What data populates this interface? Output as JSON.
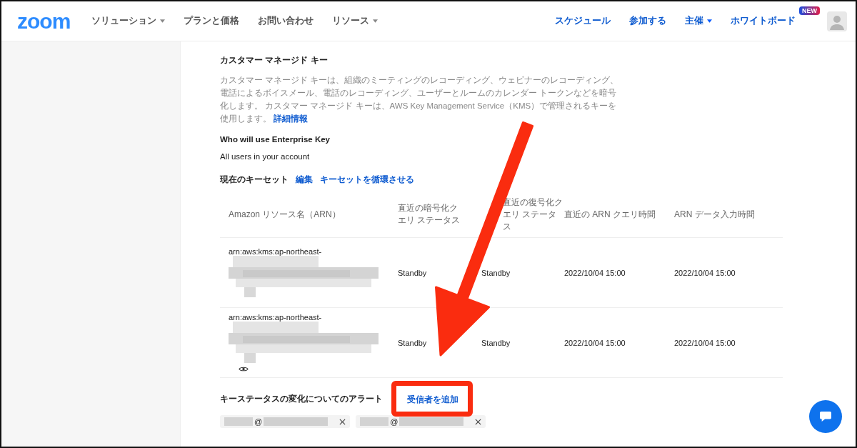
{
  "nav": {
    "logo": "zoom",
    "left_menu": [
      {
        "label": "ソリューション",
        "dropdown": true
      },
      {
        "label": "プランと価格",
        "dropdown": false
      },
      {
        "label": "お問い合わせ",
        "dropdown": false
      },
      {
        "label": "リソース",
        "dropdown": true
      }
    ],
    "right_menu": [
      {
        "label": "スケジュール",
        "dropdown": false
      },
      {
        "label": "参加する",
        "dropdown": false
      },
      {
        "label": "主催",
        "dropdown": true
      },
      {
        "label": "ホワイトボード",
        "dropdown": false,
        "badge": "NEW"
      }
    ]
  },
  "section": {
    "title": "カスタマー マネージド キー",
    "description": "カスタマー マネージド キーは、組織のミーティングのレコーディング、ウェビナーのレコーディング、電話によるボイスメール、電話のレコーディング、ユーザーとルームのカレンダー トークンなどを暗号化します。 カスタマー マネージド キーは、AWS Key Management Service（KMS）で管理されるキーを使用します。",
    "more_link": "詳細情報",
    "who_label": "Who will use Enterprise Key",
    "who_value": "All users in your account"
  },
  "keyset": {
    "title": "現在のキーセット",
    "links": [
      "編集",
      "キーセットを循環させる"
    ],
    "columns": [
      "Amazon リソース名（ARN）",
      "直近の暗号化クエリ ステータス",
      "直近の復号化クエリ ステータス",
      "直近の ARN クエリ時間",
      "ARN データ入力時間"
    ],
    "rows": [
      {
        "arn": "arn:aws:kms:ap-northeast-",
        "encrypt_status": "Standby",
        "decrypt_status": "Standby",
        "query_time": "2022/10/04 15:00",
        "input_time": "2022/10/04 15:00",
        "show_toggle": false
      },
      {
        "arn": "arn:aws:kms:ap-northeast-",
        "encrypt_status": "Standby",
        "decrypt_status": "Standby",
        "query_time": "2022/10/04 15:00",
        "input_time": "2022/10/04 15:00",
        "show_toggle": true
      }
    ]
  },
  "alerts": {
    "title": "キーステータスの変化についてのアラート",
    "add_link": "受信者を追加",
    "recipients": [
      {
        "text": "@"
      },
      {
        "text": "@"
      }
    ]
  },
  "annotation": {
    "highlight": true,
    "arrow": true
  }
}
